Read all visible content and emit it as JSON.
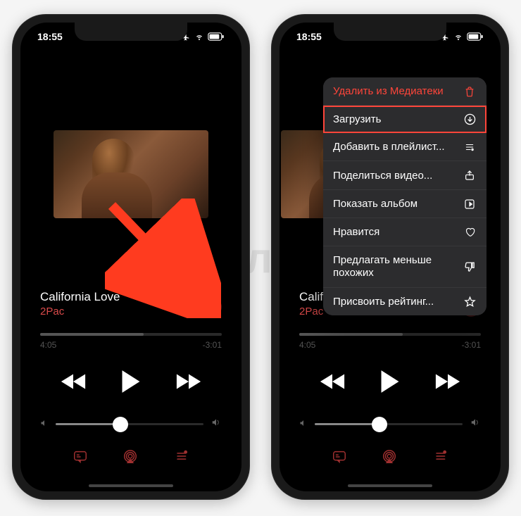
{
  "watermark": "Яблык",
  "status": {
    "time": "18:55"
  },
  "track": {
    "title": "California Love",
    "artist": "2Pac",
    "elapsed": "4:05",
    "remaining": "-3:01"
  },
  "menu": {
    "items": [
      {
        "label": "Удалить из Медиатеки",
        "icon": "trash-icon",
        "destructive": true
      },
      {
        "label": "Загрузить",
        "icon": "download-icon",
        "highlight": true
      },
      {
        "label": "Добавить в плейлист...",
        "icon": "playlist-add-icon"
      },
      {
        "label": "Поделиться видео...",
        "icon": "share-icon"
      },
      {
        "label": "Показать альбом",
        "icon": "album-icon"
      },
      {
        "label": "Нравится",
        "icon": "heart-icon"
      },
      {
        "label": "Предлагать меньше похожих",
        "icon": "thumbs-down-icon"
      },
      {
        "label": "Присвоить рейтинг...",
        "icon": "star-icon"
      }
    ]
  }
}
